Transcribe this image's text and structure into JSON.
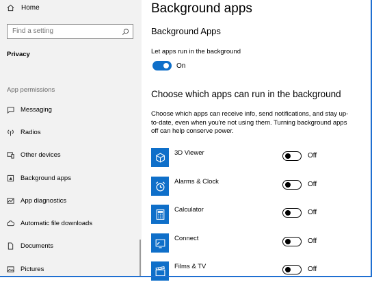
{
  "sidebar": {
    "home_label": "Home",
    "search_placeholder": "Find a setting",
    "section_title": "Privacy",
    "group_label": "App permissions",
    "items": [
      {
        "label": "Messaging",
        "icon": "messaging-icon"
      },
      {
        "label": "Radios",
        "icon": "radios-icon"
      },
      {
        "label": "Other devices",
        "icon": "other-devices-icon"
      },
      {
        "label": "Background apps",
        "icon": "background-apps-icon"
      },
      {
        "label": "App diagnostics",
        "icon": "app-diagnostics-icon"
      },
      {
        "label": "Automatic file downloads",
        "icon": "cloud-icon"
      },
      {
        "label": "Documents",
        "icon": "document-icon"
      },
      {
        "label": "Pictures",
        "icon": "pictures-icon"
      }
    ]
  },
  "main": {
    "title": "Background apps",
    "subtitle": "Background Apps",
    "run_label": "Let apps run in the background",
    "run_state": "On",
    "choose_title": "Choose which apps can run in the background",
    "description": "Choose which apps can receive info, send notifications, and stay up-to-date, even when you're not using them. Turning background apps off can help conserve power.",
    "apps": [
      {
        "name": "3D Viewer",
        "state": "Off",
        "icon": "cube-icon"
      },
      {
        "name": "Alarms & Clock",
        "state": "Off",
        "icon": "alarm-clock-icon"
      },
      {
        "name": "Calculator",
        "state": "Off",
        "icon": "calculator-icon"
      },
      {
        "name": "Connect",
        "state": "Off",
        "icon": "connect-icon"
      },
      {
        "name": "Films & TV",
        "state": "Off",
        "icon": "film-icon"
      }
    ]
  },
  "colors": {
    "accent": "#0f6fc9",
    "sidebar_bg": "#f2f2f2",
    "frame": "#1f6fd1"
  }
}
